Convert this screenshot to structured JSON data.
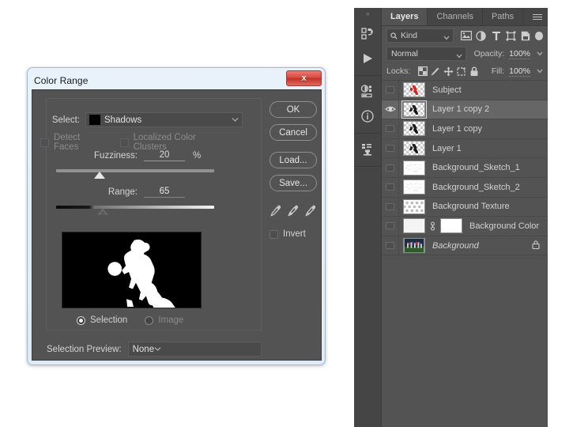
{
  "dialog": {
    "title": "Color Range",
    "close_label": "x",
    "select_label": "Select:",
    "select_value": "Shadows",
    "select_swatch_color": "#000000",
    "detect_faces_label": "Detect Faces",
    "localized_clusters_label": "Localized Color Clusters",
    "fuzziness_label": "Fuzziness:",
    "fuzziness_value": "20",
    "fuzziness_unit": "%",
    "fuzziness_slider_pct": 24,
    "range_label": "Range:",
    "range_value": "65",
    "range_slider_pct": 26,
    "selection_radio_label": "Selection",
    "image_radio_label": "Image",
    "selection_preview_label": "Selection Preview:",
    "selection_preview_value": "None",
    "invert_label": "Invert",
    "buttons": {
      "ok": "OK",
      "cancel": "Cancel",
      "load": "Load...",
      "save": "Save..."
    },
    "eyedroppers": [
      "eyedropper-icon",
      "eyedropper-add-icon",
      "eyedropper-subtract-icon"
    ]
  },
  "panel": {
    "tabs": [
      {
        "label": "Layers",
        "active": true
      },
      {
        "label": "Channels",
        "active": false
      },
      {
        "label": "Paths",
        "active": false
      }
    ],
    "filter": {
      "kind_label": "Kind",
      "icons": [
        "pixel-filter-icon",
        "adjustment-filter-icon",
        "type-filter-icon",
        "shape-filter-icon",
        "smartobject-filter-icon"
      ],
      "toggle": "filter-enable-toggle"
    },
    "blend": {
      "mode": "Normal",
      "opacity_label": "Opacity:",
      "opacity_value": "100%"
    },
    "locks": {
      "label": "Locks:",
      "icons": [
        "lock-transparency-icon",
        "lock-image-icon",
        "lock-position-icon",
        "lock-artboard-icon",
        "lock-all-icon"
      ],
      "fill_label": "Fill:",
      "fill_value": "100%"
    },
    "layers": [
      {
        "name": "Subject",
        "visible": false,
        "selected": false,
        "thumb": "figure-red",
        "italic": false,
        "locked": false,
        "has_mask": false
      },
      {
        "name": "Layer 1 copy 2",
        "visible": true,
        "selected": true,
        "thumb": "figure-black",
        "italic": false,
        "locked": false,
        "has_mask": false
      },
      {
        "name": "Layer 1 copy",
        "visible": false,
        "selected": false,
        "thumb": "figure-black",
        "italic": false,
        "locked": false,
        "has_mask": false
      },
      {
        "name": "Layer 1",
        "visible": false,
        "selected": false,
        "thumb": "figure-black",
        "italic": false,
        "locked": false,
        "has_mask": false
      },
      {
        "name": "Background_Sketch_1",
        "visible": false,
        "selected": false,
        "thumb": "sketch",
        "italic": false,
        "locked": false,
        "has_mask": false
      },
      {
        "name": "Background_Sketch_2",
        "visible": false,
        "selected": false,
        "thumb": "sketch",
        "italic": false,
        "locked": false,
        "has_mask": false
      },
      {
        "name": "Background Texture",
        "visible": false,
        "selected": false,
        "thumb": "texture",
        "italic": false,
        "locked": false,
        "has_mask": false
      },
      {
        "name": "Background Color",
        "visible": false,
        "selected": false,
        "thumb": "solid-white",
        "italic": false,
        "locked": false,
        "has_mask": true
      },
      {
        "name": "Background",
        "visible": false,
        "selected": false,
        "thumb": "photo",
        "italic": true,
        "locked": true,
        "has_mask": false
      }
    ],
    "rail": {
      "handle": "«",
      "icons": [
        "libraries-icon",
        "play-icon",
        "adjustments-icon",
        "info-icon",
        "styles-icon"
      ]
    }
  },
  "colors": {
    "panel_bg": "#535353",
    "panel_dark": "#454545",
    "dialog_frame": "#dfeaf6",
    "selection_blue": "#4a8fd4",
    "close_red": "#c03025"
  }
}
